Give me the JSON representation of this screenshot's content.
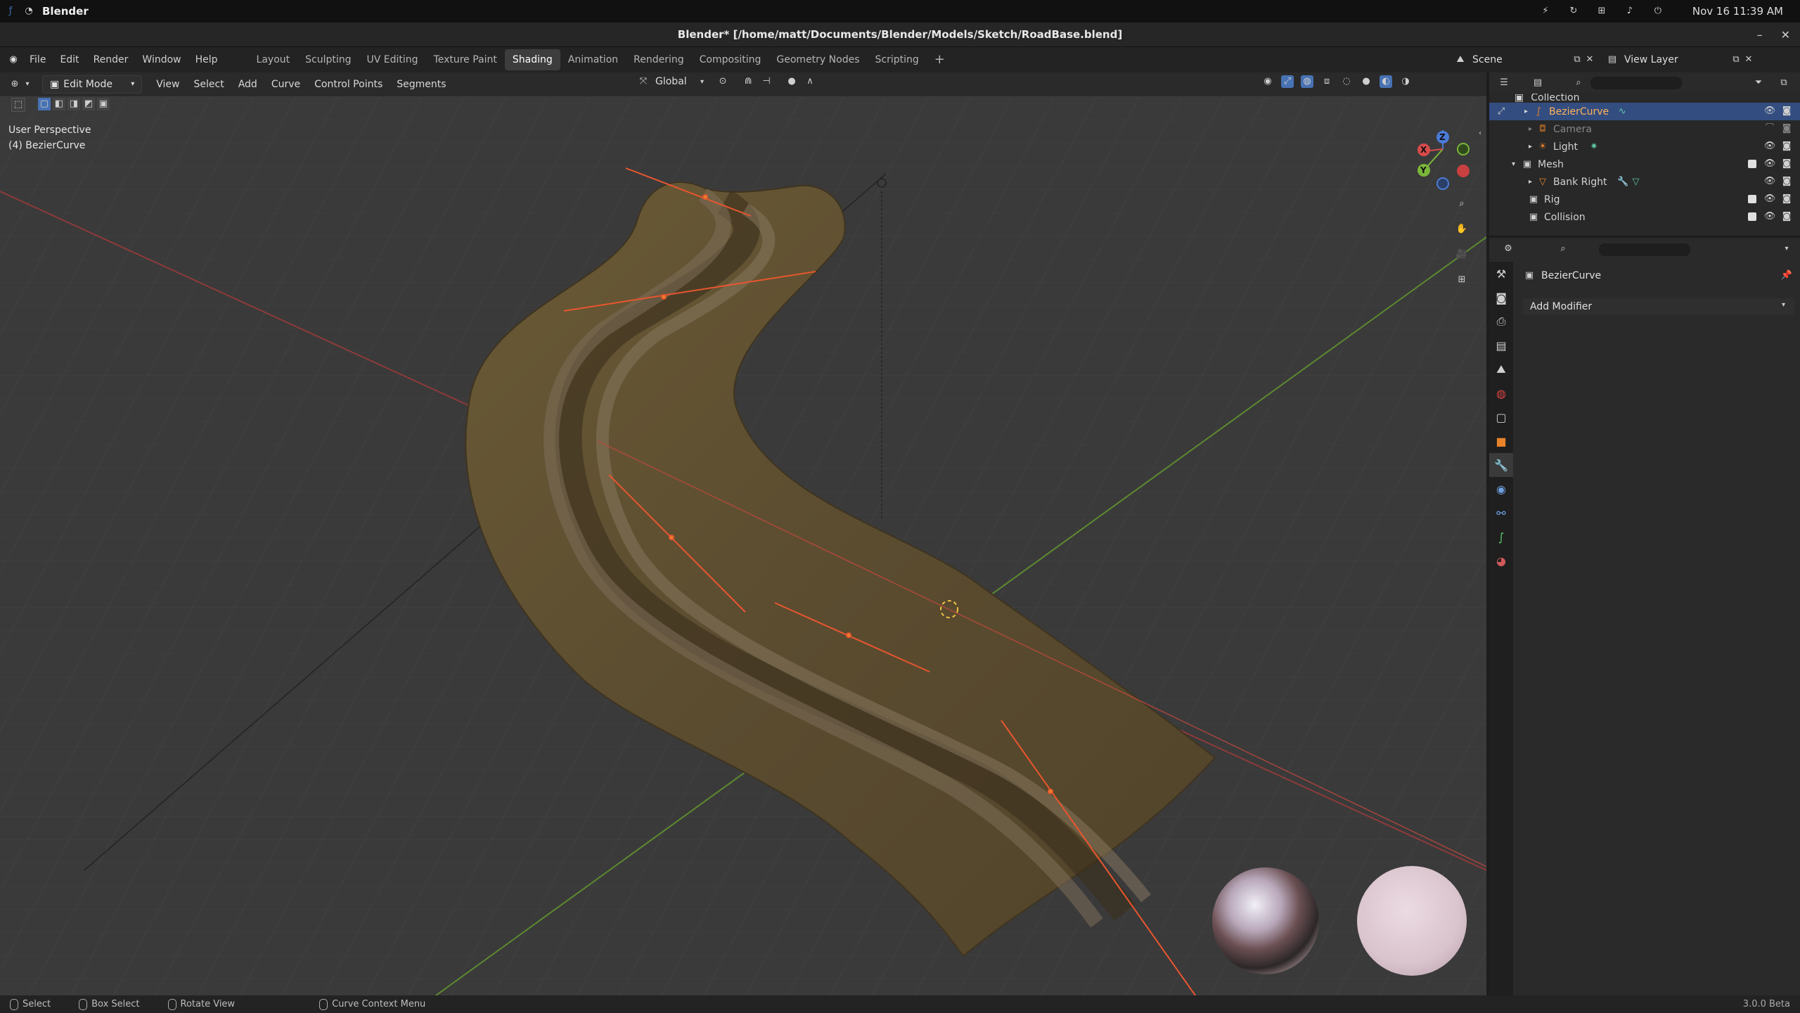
{
  "system_bar": {
    "app_name": "Blender",
    "datetime": "Nov 16  11:39 AM"
  },
  "window": {
    "title": "Blender* [/home/matt/Documents/Blender/Models/Sketch/RoadBase.blend]"
  },
  "menu": {
    "items": [
      "File",
      "Edit",
      "Render",
      "Window",
      "Help"
    ]
  },
  "workspaces": {
    "tabs": [
      "Layout",
      "Sculpting",
      "UV Editing",
      "Texture Paint",
      "Shading",
      "Animation",
      "Rendering",
      "Compositing",
      "Geometry Nodes",
      "Scripting"
    ],
    "active": "Shading"
  },
  "scene": {
    "name": "Scene",
    "view_layer": "View Layer"
  },
  "viewport_header": {
    "mode": "Edit Mode",
    "menus": [
      "View",
      "Select",
      "Add",
      "Curve",
      "Control Points",
      "Segments"
    ],
    "orientation": "Global"
  },
  "viewport": {
    "perspective": "User Perspective",
    "object": "(4) BezierCurve",
    "gizmo_axes": [
      "X",
      "Y",
      "Z"
    ]
  },
  "outliner": {
    "rows": [
      {
        "label": "Collection",
        "type": "collection"
      },
      {
        "label": "BezierCurve",
        "type": "curve",
        "selected": true
      },
      {
        "label": "Camera",
        "type": "camera"
      },
      {
        "label": "Light",
        "type": "light"
      },
      {
        "label": "Mesh",
        "type": "collection"
      },
      {
        "label": "Bank Right",
        "type": "mesh"
      },
      {
        "label": "Rig",
        "type": "collection"
      },
      {
        "label": "Collision",
        "type": "collection"
      }
    ]
  },
  "properties": {
    "object_name": "BezierCurve",
    "add_modifier": "Add Modifier"
  },
  "status_bar": {
    "select": "Select",
    "box_select": "Box Select",
    "rotate_view": "Rotate View",
    "context_menu": "Curve Context Menu",
    "version": "3.0.0 Beta"
  },
  "colors": {
    "selected_row": "#334d80",
    "accent_orange": "#e8832a",
    "viewport_bg": "#3a3a3a"
  }
}
